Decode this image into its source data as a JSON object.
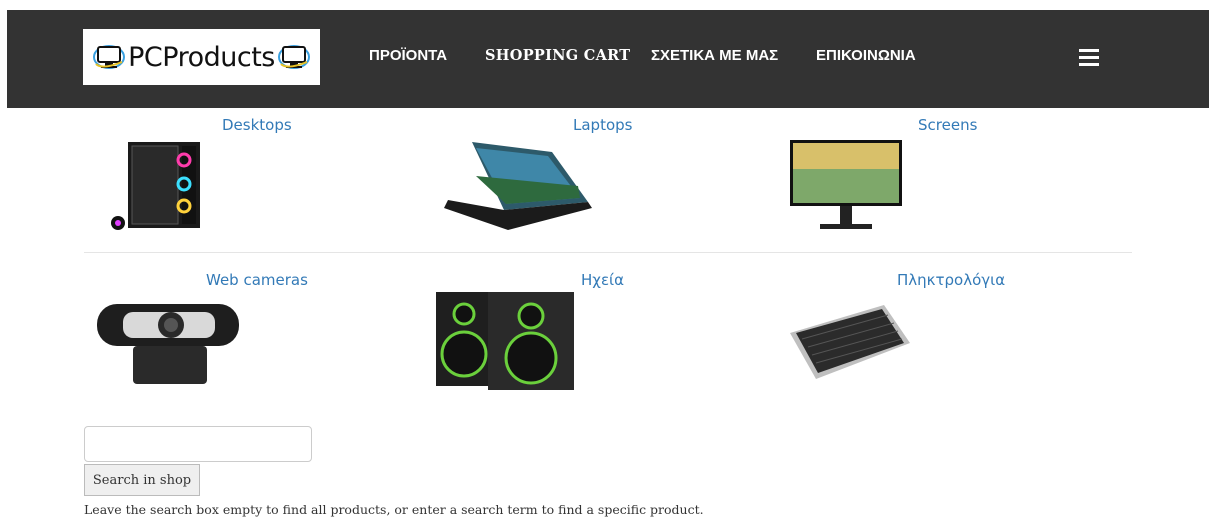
{
  "header": {
    "logo_text": "PCProducts",
    "nav": [
      {
        "label": "ΠΡΟΪΟΝΤΑ"
      },
      {
        "label": "SHOPPING CART"
      },
      {
        "label": "ΣΧΕΤΙΚΑ ΜΕ ΜΑΣ"
      },
      {
        "label": "ΕΠΙΚΟΙΝΩΝΙΑ"
      }
    ],
    "menu_icon": "hamburger-menu-icon"
  },
  "categories": [
    {
      "title": "Desktops",
      "icon": "desktop-tower-image"
    },
    {
      "title": "Laptops",
      "icon": "laptop-image"
    },
    {
      "title": "Screens",
      "icon": "monitor-image"
    },
    {
      "title": "Web cameras",
      "icon": "webcam-image"
    },
    {
      "title": "Ηχεία",
      "icon": "speakers-image"
    },
    {
      "title": "Πληκτρολόγια",
      "icon": "keyboard-image"
    }
  ],
  "search": {
    "value": "",
    "placeholder": "",
    "button_label": "Search in shop",
    "hint": "Leave the search box empty to find all products, or enter a search term to find a specific product."
  },
  "colors": {
    "header_bg": "#333333",
    "link": "#337ab7"
  }
}
